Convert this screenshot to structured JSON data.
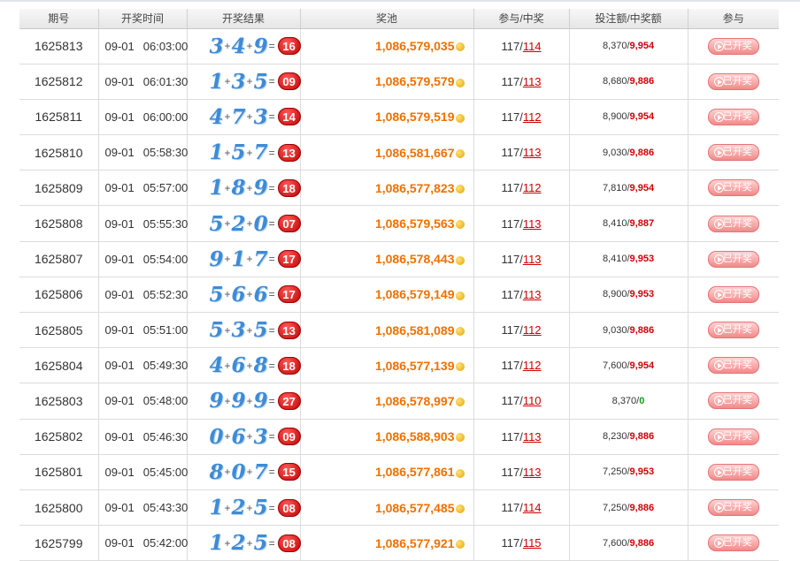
{
  "header": {
    "issue": "期号",
    "time": "开奖时间",
    "result": "开奖结果",
    "pool": "奖池",
    "participate": "参与/中奖",
    "bet": "投注额/中奖额",
    "join": "参与"
  },
  "button_label": "已开奖",
  "colors": {
    "pool": "#f07000",
    "win_amount": "#d40000",
    "zero_win": "#1a9a1a",
    "sum_ball": "#c40000",
    "digit": "#3f8bd6"
  },
  "rows": [
    {
      "issue": "1625813",
      "date": "09-01",
      "time": "06:03:00",
      "n1": "3",
      "n2": "4",
      "n3": "9",
      "sum": "16",
      "pool": "1,086,579,035",
      "players": "117",
      "winners": "114",
      "bet": "8,370",
      "win": "9,954"
    },
    {
      "issue": "1625812",
      "date": "09-01",
      "time": "06:01:30",
      "n1": "1",
      "n2": "3",
      "n3": "5",
      "sum": "09",
      "pool": "1,086,579,579",
      "players": "117",
      "winners": "113",
      "bet": "8,680",
      "win": "9,886"
    },
    {
      "issue": "1625811",
      "date": "09-01",
      "time": "06:00:00",
      "n1": "4",
      "n2": "7",
      "n3": "3",
      "sum": "14",
      "pool": "1,086,579,519",
      "players": "117",
      "winners": "112",
      "bet": "8,900",
      "win": "9,954"
    },
    {
      "issue": "1625810",
      "date": "09-01",
      "time": "05:58:30",
      "n1": "1",
      "n2": "5",
      "n3": "7",
      "sum": "13",
      "pool": "1,086,581,667",
      "players": "117",
      "winners": "113",
      "bet": "9,030",
      "win": "9,886"
    },
    {
      "issue": "1625809",
      "date": "09-01",
      "time": "05:57:00",
      "n1": "1",
      "n2": "8",
      "n3": "9",
      "sum": "18",
      "pool": "1,086,577,823",
      "players": "117",
      "winners": "112",
      "bet": "7,810",
      "win": "9,954"
    },
    {
      "issue": "1625808",
      "date": "09-01",
      "time": "05:55:30",
      "n1": "5",
      "n2": "2",
      "n3": "0",
      "sum": "07",
      "pool": "1,086,579,563",
      "players": "117",
      "winners": "113",
      "bet": "8,410",
      "win": "9,887"
    },
    {
      "issue": "1625807",
      "date": "09-01",
      "time": "05:54:00",
      "n1": "9",
      "n2": "1",
      "n3": "7",
      "sum": "17",
      "pool": "1,086,578,443",
      "players": "117",
      "winners": "113",
      "bet": "8,410",
      "win": "9,953"
    },
    {
      "issue": "1625806",
      "date": "09-01",
      "time": "05:52:30",
      "n1": "5",
      "n2": "6",
      "n3": "6",
      "sum": "17",
      "pool": "1,086,579,149",
      "players": "117",
      "winners": "113",
      "bet": "8,900",
      "win": "9,953"
    },
    {
      "issue": "1625805",
      "date": "09-01",
      "time": "05:51:00",
      "n1": "5",
      "n2": "3",
      "n3": "5",
      "sum": "13",
      "pool": "1,086,581,089",
      "players": "117",
      "winners": "112",
      "bet": "9,030",
      "win": "9,886"
    },
    {
      "issue": "1625804",
      "date": "09-01",
      "time": "05:49:30",
      "n1": "4",
      "n2": "6",
      "n3": "8",
      "sum": "18",
      "pool": "1,086,577,139",
      "players": "117",
      "winners": "112",
      "bet": "7,600",
      "win": "9,954"
    },
    {
      "issue": "1625803",
      "date": "09-01",
      "time": "05:48:00",
      "n1": "9",
      "n2": "9",
      "n3": "9",
      "sum": "27",
      "pool": "1,086,578,997",
      "players": "117",
      "winners": "110",
      "bet": "8,370",
      "win": "0"
    },
    {
      "issue": "1625802",
      "date": "09-01",
      "time": "05:46:30",
      "n1": "0",
      "n2": "6",
      "n3": "3",
      "sum": "09",
      "pool": "1,086,588,903",
      "players": "117",
      "winners": "113",
      "bet": "8,230",
      "win": "9,886"
    },
    {
      "issue": "1625801",
      "date": "09-01",
      "time": "05:45:00",
      "n1": "8",
      "n2": "0",
      "n3": "7",
      "sum": "15",
      "pool": "1,086,577,861",
      "players": "117",
      "winners": "113",
      "bet": "7,250",
      "win": "9,953"
    },
    {
      "issue": "1625800",
      "date": "09-01",
      "time": "05:43:30",
      "n1": "1",
      "n2": "2",
      "n3": "5",
      "sum": "08",
      "pool": "1,086,577,485",
      "players": "117",
      "winners": "114",
      "bet": "7,250",
      "win": "9,886"
    },
    {
      "issue": "1625799",
      "date": "09-01",
      "time": "05:42:00",
      "n1": "1",
      "n2": "2",
      "n3": "5",
      "sum": "08",
      "pool": "1,086,577,921",
      "players": "117",
      "winners": "115",
      "bet": "7,600",
      "win": "9,886"
    }
  ]
}
